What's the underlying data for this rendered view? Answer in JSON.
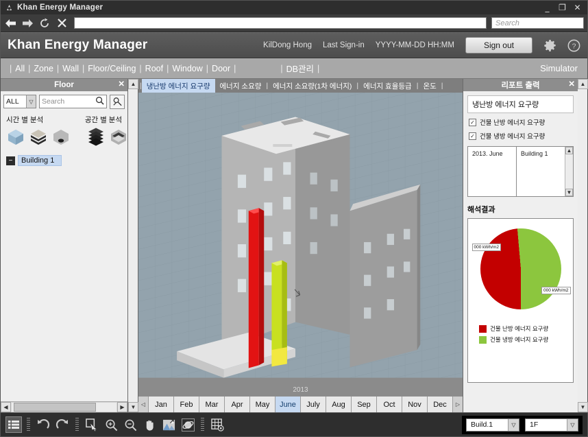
{
  "window": {
    "title": "Khan Energy Manager",
    "logo_icon": "app-logo-icon",
    "minimize": "_",
    "maximize": "❐",
    "close": "✕"
  },
  "navbar": {
    "back_icon": "←",
    "forward_icon": "→",
    "reload_icon": "↻",
    "stop_icon": "✕",
    "address_value": "",
    "search_placeholder": "Search"
  },
  "header": {
    "brand": "Khan Energy Manager",
    "user": "KilDong Hong",
    "last_signin_label": "Last Sign-in",
    "last_signin_value": "YYYY-MM-DD  HH:MM",
    "signout_label": "Sign out",
    "settings_icon": "gear-icon",
    "help_icon": "help-icon"
  },
  "menubar": {
    "separator": "|",
    "items": [
      {
        "label": "All"
      },
      {
        "label": "Zone"
      },
      {
        "label": "Wall"
      },
      {
        "label": "Floor/Ceiling"
      },
      {
        "label": "Roof"
      },
      {
        "label": "Window"
      },
      {
        "label": "Door"
      }
    ],
    "db_item": {
      "label": "DB관리"
    },
    "simulator_label": "Simulator"
  },
  "left_panel": {
    "title": "Floor",
    "close_icon": "✕",
    "filter_value": "ALL",
    "filter_arrow": "▽",
    "search_placeholder": "Search",
    "search_icon": "search-icon",
    "advanced_icon": "advanced-search-icon",
    "analysis_time_label": "시간 별 분석",
    "analysis_space_label": "공간 별 분석",
    "tree": {
      "toggle": "−",
      "node_label": "Building  1"
    },
    "scroll_left": "◀",
    "scroll_right": "▶",
    "scroll_up": "▲",
    "scroll_down": "▼"
  },
  "center": {
    "tabs": [
      {
        "label": "냉난방 에너지 요구량",
        "active": true
      },
      {
        "label": "에너지 소요량",
        "active": false
      },
      {
        "label": "에너지 소요량(1차 에너지)",
        "active": false
      },
      {
        "label": "에너지 효율등급",
        "active": false
      },
      {
        "label": "온도",
        "active": false
      }
    ],
    "tab_separator": "|",
    "viewport_year": "2013",
    "months": [
      {
        "label": "Jan",
        "active": false
      },
      {
        "label": "Feb",
        "active": false
      },
      {
        "label": "Mar",
        "active": false
      },
      {
        "label": "Apr",
        "active": false
      },
      {
        "label": "May",
        "active": false
      },
      {
        "label": "June",
        "active": true
      },
      {
        "label": "July",
        "active": false
      },
      {
        "label": "Aug",
        "active": false
      },
      {
        "label": "Sep",
        "active": false
      },
      {
        "label": "Oct",
        "active": false
      },
      {
        "label": "Nov",
        "active": false
      },
      {
        "label": "Dec",
        "active": false
      }
    ],
    "month_prev": "◁",
    "month_next": "▷"
  },
  "right_panel": {
    "title": "리포트 출력",
    "close_icon": "✕",
    "section_header": "냉난방 에너지 요구량",
    "checkboxes": [
      {
        "label": "건물 난방 에너지 요구량",
        "checked": true,
        "mark": "✓"
      },
      {
        "label": "건물 냉방 에너지 요구량",
        "checked": true,
        "mark": "✓"
      }
    ],
    "table": {
      "period": "2013. June",
      "building": "Building  1"
    },
    "results_label": "해석결과",
    "scroll_up": "▲",
    "scroll_down": "▼"
  },
  "chart_data": {
    "type": "pie",
    "title": "해석결과",
    "labels": [
      "건물 난방 에너지 요구량",
      "건물 냉방 에너지 요구량"
    ],
    "values": [
      48.6,
      51.4
    ],
    "data_labels": [
      "000 kWh/m2",
      "000 kWh/m2"
    ],
    "colors": [
      "#c30000",
      "#8cc63e"
    ],
    "legend_position": "bottom",
    "unit": "kWh/m2"
  },
  "bottom_bar": {
    "icons": [
      {
        "name": "list-view-icon",
        "selected": true
      },
      {
        "name": "undo-icon",
        "selected": false
      },
      {
        "name": "redo-icon",
        "selected": false
      },
      {
        "name": "select-cursor-icon",
        "selected": false
      },
      {
        "name": "zoom-in-icon",
        "selected": false
      },
      {
        "name": "zoom-out-icon",
        "selected": false
      },
      {
        "name": "pan-hand-icon",
        "selected": false
      },
      {
        "name": "fit-view-icon",
        "selected": false
      },
      {
        "name": "orbit-rotate-icon",
        "selected": false
      },
      {
        "name": "grid-settings-icon",
        "selected": false
      }
    ],
    "building_select": "Build.1",
    "floor_select": "1F",
    "select_arrow": "▽"
  }
}
